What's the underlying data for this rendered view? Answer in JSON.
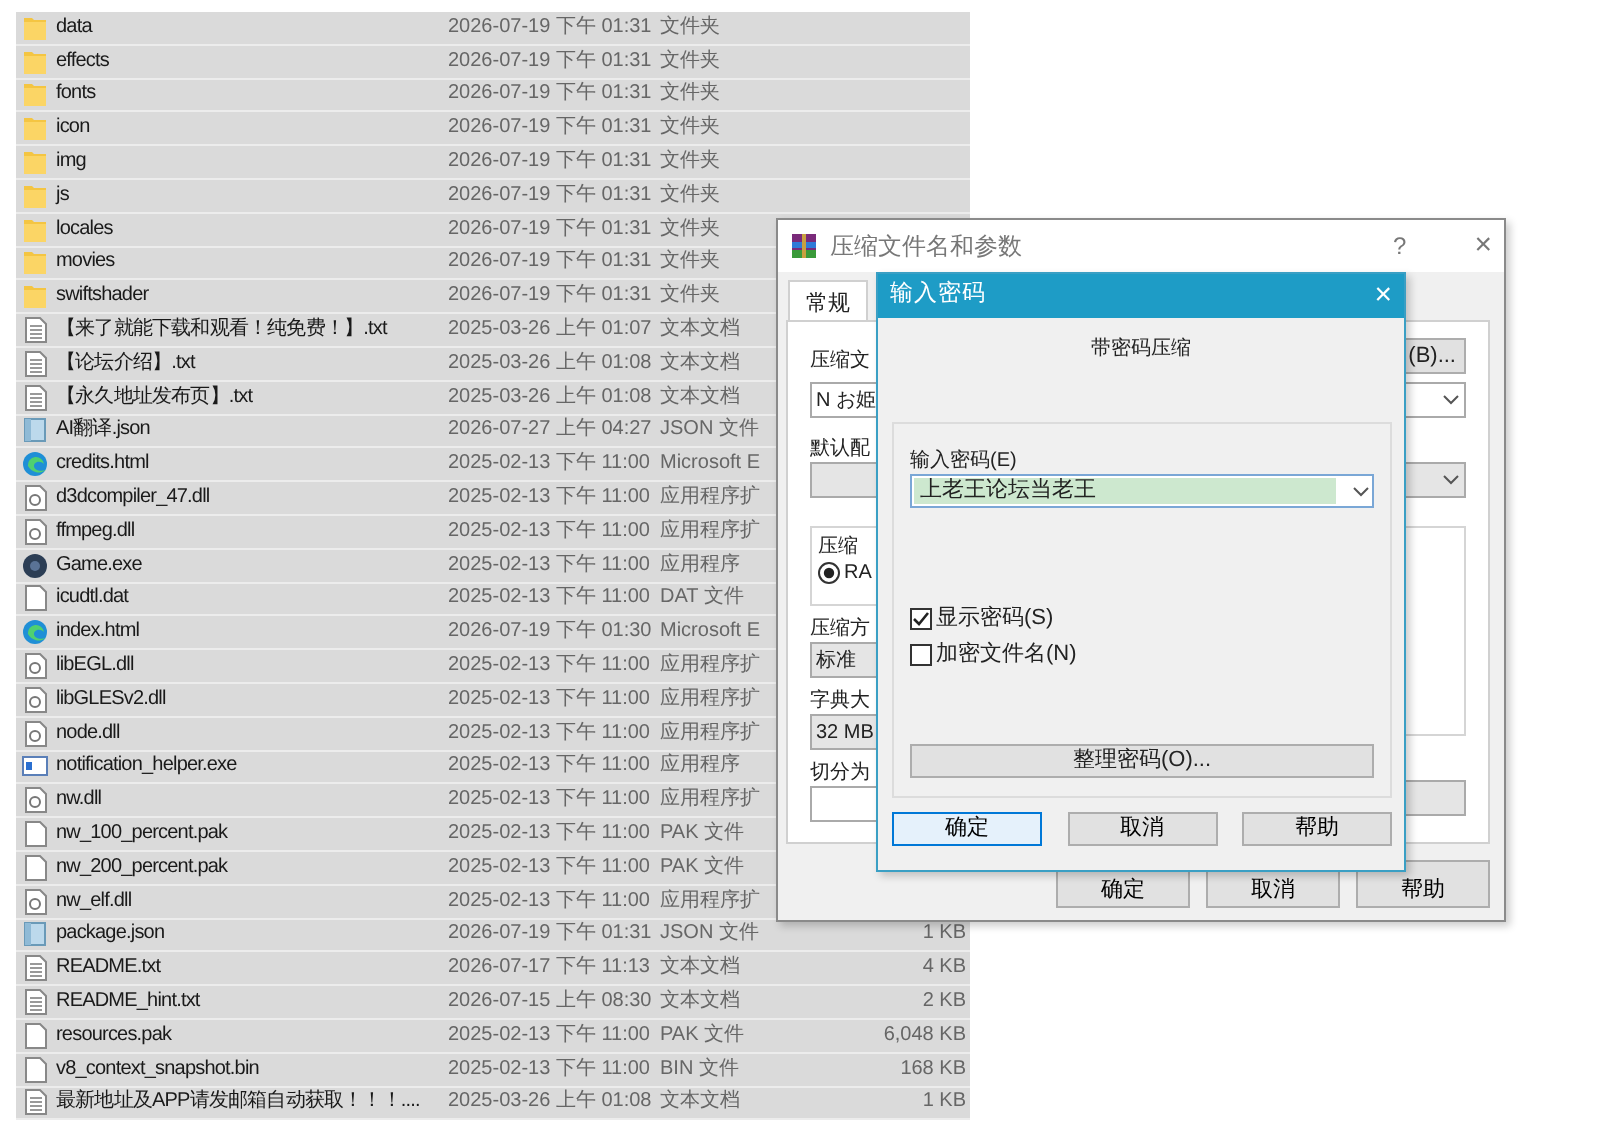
{
  "file_list": {
    "rows": [
      {
        "kind": "folder",
        "name": "data",
        "date": "2026-07-19 下午 01:31",
        "type": "文件夹"
      },
      {
        "kind": "folder",
        "name": "effects",
        "date": "2026-07-19 下午 01:31",
        "type": "文件夹"
      },
      {
        "kind": "folder",
        "name": "fonts",
        "date": "2026-07-19 下午 01:31",
        "type": "文件夹"
      },
      {
        "kind": "folder",
        "name": "icon",
        "date": "2026-07-19 下午 01:31",
        "type": "文件夹"
      },
      {
        "kind": "folder",
        "name": "img",
        "date": "2026-07-19 下午 01:31",
        "type": "文件夹"
      },
      {
        "kind": "folder",
        "name": "js",
        "date": "2026-07-19 下午 01:31",
        "type": "文件夹"
      },
      {
        "kind": "folder",
        "name": "locales",
        "date": "2026-07-19 下午 01:31",
        "type": "文件夹"
      },
      {
        "kind": "folder",
        "name": "movies",
        "date": "2026-07-19 下午 01:31",
        "type": "文件夹"
      },
      {
        "kind": "folder",
        "name": "swiftshader",
        "date": "2026-07-19 下午 01:31",
        "type": "文件夹"
      },
      {
        "kind": "text",
        "name": "【来了就能下载和观看！纯免费！】.txt",
        "date": "2025-03-26 上午 01:07",
        "type": "文本文档"
      },
      {
        "kind": "text",
        "name": "【论坛介绍】.txt",
        "date": "2025-03-26 上午 01:08",
        "type": "文本文档"
      },
      {
        "kind": "text",
        "name": "【永久地址发布页】.txt",
        "date": "2025-03-26 上午 01:08",
        "type": "文本文档"
      },
      {
        "kind": "json",
        "name": "AI翻译.json",
        "date": "2026-07-27 上午 04:27",
        "type": "JSON 文件"
      },
      {
        "kind": "web",
        "name": "credits.html",
        "date": "2025-02-13 下午 11:00",
        "type": "Microsoft E"
      },
      {
        "kind": "dll",
        "name": "d3dcompiler_47.dll",
        "date": "2025-02-13 下午 11:00",
        "type": "应用程序扩"
      },
      {
        "kind": "dll",
        "name": "ffmpeg.dll",
        "date": "2025-02-13 下午 11:00",
        "type": "应用程序扩"
      },
      {
        "kind": "game",
        "name": "Game.exe",
        "date": "2025-02-13 下午 11:00",
        "type": "应用程序"
      },
      {
        "kind": "blank",
        "name": "icudtl.dat",
        "date": "2025-02-13 下午 11:00",
        "type": "DAT 文件"
      },
      {
        "kind": "web",
        "name": "index.html",
        "date": "2026-07-19 下午 01:30",
        "type": "Microsoft E"
      },
      {
        "kind": "dll",
        "name": "libEGL.dll",
        "date": "2025-02-13 下午 11:00",
        "type": "应用程序扩"
      },
      {
        "kind": "dll",
        "name": "libGLESv2.dll",
        "date": "2025-02-13 下午 11:00",
        "type": "应用程序扩"
      },
      {
        "kind": "dll",
        "name": "node.dll",
        "date": "2025-02-13 下午 11:00",
        "type": "应用程序扩"
      },
      {
        "kind": "app",
        "name": "notification_helper.exe",
        "date": "2025-02-13 下午 11:00",
        "type": "应用程序"
      },
      {
        "kind": "dll",
        "name": "nw.dll",
        "date": "2025-02-13 下午 11:00",
        "type": "应用程序扩"
      },
      {
        "kind": "blank",
        "name": "nw_100_percent.pak",
        "date": "2025-02-13 下午 11:00",
        "type": "PAK 文件"
      },
      {
        "kind": "blank",
        "name": "nw_200_percent.pak",
        "date": "2025-02-13 下午 11:00",
        "type": "PAK 文件"
      },
      {
        "kind": "dll",
        "name": "nw_elf.dll",
        "date": "2025-02-13 下午 11:00",
        "type": "应用程序扩"
      },
      {
        "kind": "json",
        "name": "package.json",
        "date": "2026-07-19 下午 01:31",
        "type": "JSON 文件",
        "size": "1 KB"
      },
      {
        "kind": "text",
        "name": "README.txt",
        "date": "2026-07-17 下午 11:13",
        "type": "文本文档",
        "size": "4 KB"
      },
      {
        "kind": "text",
        "name": "README_hint.txt",
        "date": "2026-07-15 上午 08:30",
        "type": "文本文档",
        "size": "2 KB"
      },
      {
        "kind": "blank",
        "name": "resources.pak",
        "date": "2025-02-13 下午 11:00",
        "type": "PAK 文件",
        "size": "6,048 KB"
      },
      {
        "kind": "blank",
        "name": "v8_context_snapshot.bin",
        "date": "2025-02-13 下午 11:00",
        "type": "BIN 文件",
        "size": "168 KB"
      },
      {
        "kind": "text",
        "name": "最新地址及APP请发邮箱自动获取！！！....",
        "date": "2025-03-26 上午 01:08",
        "type": "文本文档",
        "size": "1 KB"
      }
    ]
  },
  "archive_dialog": {
    "title": "压缩文件名和参数",
    "help": "?",
    "close": "×",
    "tabs": [
      {
        "label": "常规",
        "selected": true
      }
    ],
    "archive_name_label": "压缩文",
    "browse_button": "(B)...",
    "archive_name_value": "N お姫",
    "profile_label": "默认配",
    "format_group_label": "压缩",
    "format_option": {
      "label": "RA",
      "selected": true
    },
    "method_label": "压缩方",
    "method_value": "标准",
    "dictionary_label": "字典大",
    "dictionary_value": "32 MB",
    "split_label": "切分为",
    "buttons": [
      "确定",
      "取消",
      "帮助"
    ]
  },
  "password_dialog": {
    "title": "输入密码",
    "close": "×",
    "heading": "带密码压缩",
    "password_label": "输入密码(E)",
    "password_value": "上老王论坛当老王",
    "options": [
      {
        "label": "显示密码(S)",
        "checked": true
      },
      {
        "label": "加密文件名(N)",
        "checked": false
      }
    ],
    "organize_button": "整理密码(O)...",
    "buttons": [
      {
        "label": "确定",
        "default": true
      },
      {
        "label": "取消",
        "default": false
      },
      {
        "label": "帮助",
        "default": false
      }
    ]
  }
}
